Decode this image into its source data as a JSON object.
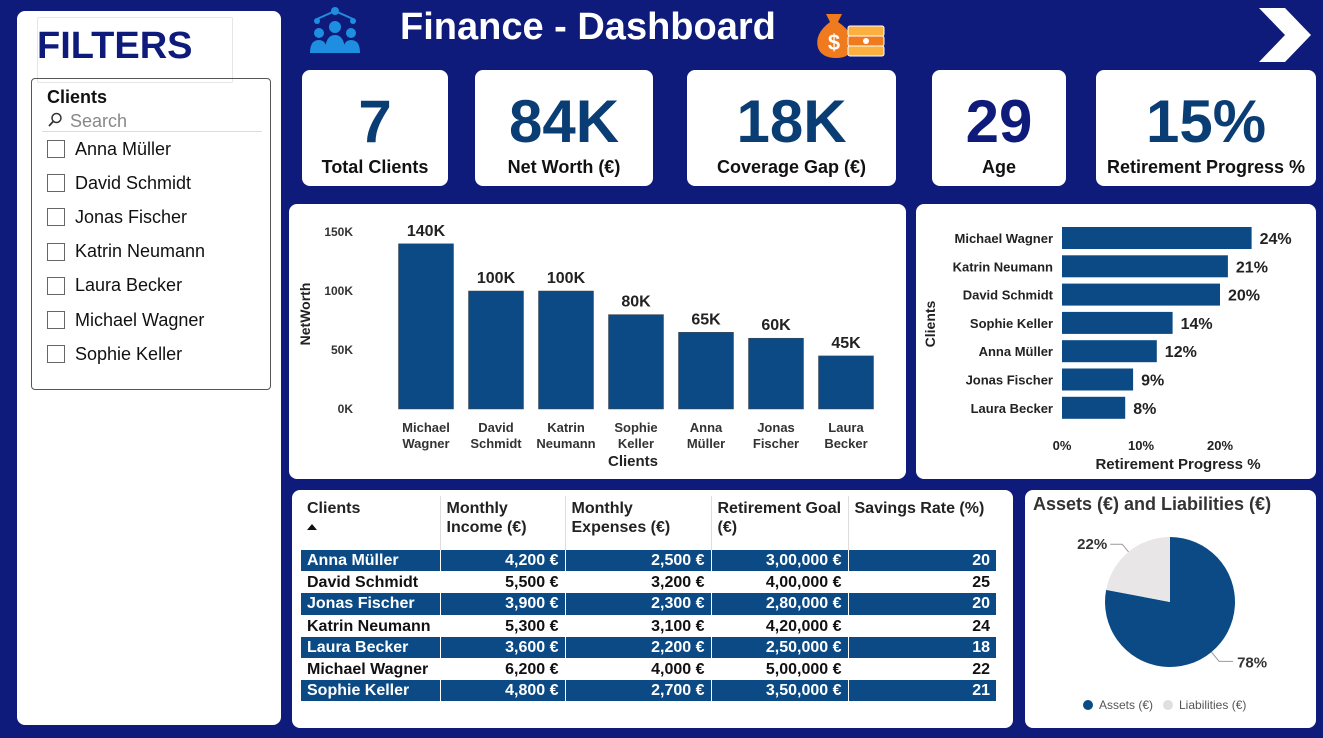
{
  "filters": {
    "title": "FILTERS",
    "slicer_title": "Clients",
    "search_placeholder": "Search",
    "items": [
      "Anna Müller",
      "David Schmidt",
      "Jonas Fischer",
      "Katrin Neumann",
      "Laura Becker",
      "Michael Wagner",
      "Sophie Keller"
    ]
  },
  "header": {
    "title": "Finance - Dashboard"
  },
  "kpis": [
    {
      "value": "7",
      "label": "Total Clients"
    },
    {
      "value": "84K",
      "label": "Net Worth (€)"
    },
    {
      "value": "18K",
      "label": "Coverage Gap (€)"
    },
    {
      "value": "29",
      "label": "Age"
    },
    {
      "value": "15%",
      "label": "Retirement Progress %"
    }
  ],
  "colors": {
    "background": "#0f1b7a",
    "primary": "#0b4a85",
    "liabilities": "#e8e6e6"
  },
  "chart_data": [
    {
      "type": "bar",
      "categories": [
        "Michael Wagner",
        "David Schmidt",
        "Katrin Neumann",
        "Sophie Keller",
        "Anna Müller",
        "Jonas Fischer",
        "Laura Becker"
      ],
      "values": [
        140000,
        100000,
        100000,
        80000,
        65000,
        60000,
        45000
      ],
      "data_labels": [
        "140K",
        "100K",
        "100K",
        "80K",
        "65K",
        "60K",
        "45K"
      ],
      "xlabel": "Clients",
      "ylabel": "NetWorth",
      "ylim": [
        0,
        150000
      ],
      "yticks": [
        "0K",
        "50K",
        "100K",
        "150K"
      ]
    },
    {
      "type": "bar",
      "orientation": "horizontal",
      "categories": [
        "Michael Wagner",
        "Katrin Neumann",
        "David Schmidt",
        "Sophie Keller",
        "Anna Müller",
        "Jonas Fischer",
        "Laura Becker"
      ],
      "values": [
        24,
        21,
        20,
        14,
        12,
        9,
        8
      ],
      "data_labels": [
        "24%",
        "21%",
        "20%",
        "14%",
        "12%",
        "9%",
        "8%"
      ],
      "xlabel": "Retirement Progress %",
      "ylabel": "Clients",
      "xlim": [
        0,
        25
      ],
      "xticks": [
        "0%",
        "10%",
        "20%"
      ]
    },
    {
      "type": "table",
      "columns": [
        "Clients",
        "Monthly Income (€)",
        "Monthly Expenses (€)",
        "Retirement Goal (€)",
        "Savings Rate (%)"
      ],
      "rows": [
        [
          "Anna Müller",
          "4,200 €",
          "2,500 €",
          "3,00,000 €",
          "20"
        ],
        [
          "David Schmidt",
          "5,500 €",
          "3,200 €",
          "4,00,000 €",
          "25"
        ],
        [
          "Jonas Fischer",
          "3,900 €",
          "2,300 €",
          "2,80,000 €",
          "20"
        ],
        [
          "Katrin Neumann",
          "5,300 €",
          "3,100 €",
          "4,20,000 €",
          "24"
        ],
        [
          "Laura Becker",
          "3,600 €",
          "2,200 €",
          "2,50,000 €",
          "18"
        ],
        [
          "Michael Wagner",
          "6,200 €",
          "4,000 €",
          "5,00,000 €",
          "22"
        ],
        [
          "Sophie Keller",
          "4,800 €",
          "2,700 €",
          "3,50,000 €",
          "21"
        ]
      ]
    },
    {
      "type": "pie",
      "title": "Assets (€) and Liabilities (€)",
      "labels": [
        "Assets (€)",
        "Liabilities (€)"
      ],
      "values": [
        78,
        22
      ],
      "data_labels": [
        "78%",
        "22%"
      ],
      "colors": [
        "#0b4a85",
        "#e8e6e6"
      ],
      "legend": "bottom"
    }
  ]
}
